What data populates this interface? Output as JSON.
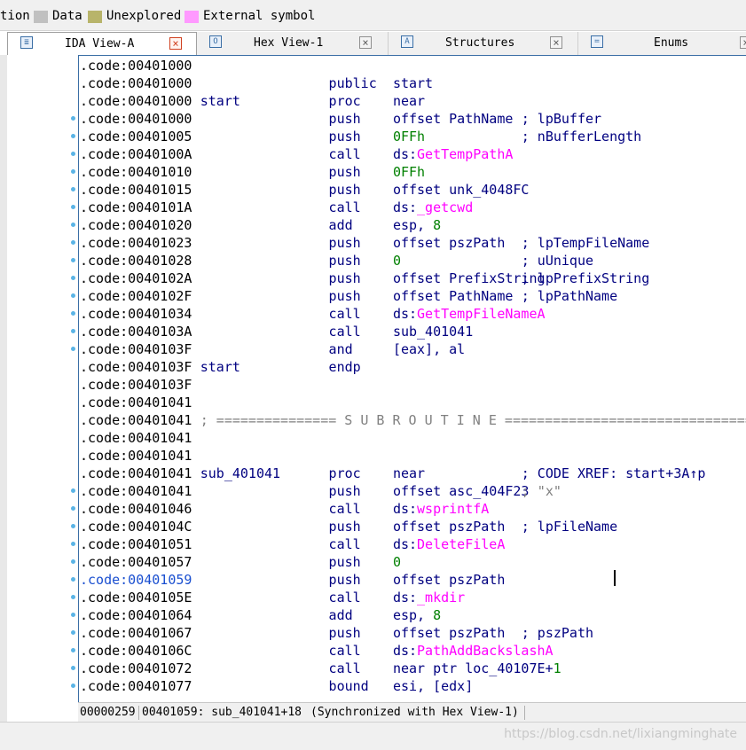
{
  "legend": [
    {
      "label": "tion",
      "color": ""
    },
    {
      "label": "Data",
      "color": "#c0c0c0"
    },
    {
      "label": "Unexplored",
      "color": "#b8b46a"
    },
    {
      "label": "External symbol",
      "color": "#ff99ff"
    }
  ],
  "tabs": [
    {
      "label": "IDA View-A",
      "icon": "ida-view-icon",
      "glyph": "≣"
    },
    {
      "label": "Hex View-1",
      "icon": "hex-view-icon",
      "glyph": "O"
    },
    {
      "label": "Structures",
      "icon": "structures-icon",
      "glyph": "A"
    },
    {
      "label": "Enums",
      "icon": "enums-icon",
      "glyph": "≔"
    }
  ],
  "listing": [
    {
      "addr": ".code:00401000",
      "label": "",
      "mnem": "",
      "ops": [],
      "comment": "",
      "bp": false
    },
    {
      "addr": ".code:00401000",
      "label": "",
      "mnem": "public",
      "ops": [
        {
          "t": "start",
          "c": "op"
        }
      ],
      "comment": "",
      "bp": false
    },
    {
      "addr": ".code:00401000",
      "label": "start",
      "mnem": "proc",
      "ops": [
        {
          "t": "near",
          "c": "op"
        }
      ],
      "comment": "",
      "bp": false
    },
    {
      "addr": ".code:00401000",
      "label": "",
      "mnem": "push",
      "ops": [
        {
          "t": "offset PathName",
          "c": "op"
        }
      ],
      "comment": "; lpBuffer",
      "bp": true
    },
    {
      "addr": ".code:00401005",
      "label": "",
      "mnem": "push",
      "ops": [
        {
          "t": "0FFh",
          "c": "num"
        }
      ],
      "comment": "; nBufferLength",
      "bp": true
    },
    {
      "addr": ".code:0040100A",
      "label": "",
      "mnem": "call",
      "ops": [
        {
          "t": "ds:",
          "c": "op"
        },
        {
          "t": "GetTempPathA",
          "c": "fn"
        }
      ],
      "comment": "",
      "bp": true
    },
    {
      "addr": ".code:00401010",
      "label": "",
      "mnem": "push",
      "ops": [
        {
          "t": "0FFh",
          "c": "num"
        }
      ],
      "comment": "",
      "bp": true
    },
    {
      "addr": ".code:00401015",
      "label": "",
      "mnem": "push",
      "ops": [
        {
          "t": "offset unk_4048FC",
          "c": "op"
        }
      ],
      "comment": "",
      "bp": true
    },
    {
      "addr": ".code:0040101A",
      "label": "",
      "mnem": "call",
      "ops": [
        {
          "t": "ds:",
          "c": "op"
        },
        {
          "t": "_getcwd",
          "c": "fn"
        }
      ],
      "comment": "",
      "bp": true
    },
    {
      "addr": ".code:00401020",
      "label": "",
      "mnem": "add",
      "ops": [
        {
          "t": "esp, ",
          "c": "op"
        },
        {
          "t": "8",
          "c": "num"
        }
      ],
      "comment": "",
      "bp": true
    },
    {
      "addr": ".code:00401023",
      "label": "",
      "mnem": "push",
      "ops": [
        {
          "t": "offset pszPath",
          "c": "op"
        }
      ],
      "comment": "; lpTempFileName",
      "bp": true
    },
    {
      "addr": ".code:00401028",
      "label": "",
      "mnem": "push",
      "ops": [
        {
          "t": "0",
          "c": "num"
        }
      ],
      "comment": "; uUnique",
      "bp": true
    },
    {
      "addr": ".code:0040102A",
      "label": "",
      "mnem": "push",
      "ops": [
        {
          "t": "offset PrefixString",
          "c": "op"
        }
      ],
      "comment": "; lpPrefixString",
      "bp": true
    },
    {
      "addr": ".code:0040102F",
      "label": "",
      "mnem": "push",
      "ops": [
        {
          "t": "offset PathName",
          "c": "op"
        }
      ],
      "comment": "; lpPathName",
      "bp": true
    },
    {
      "addr": ".code:00401034",
      "label": "",
      "mnem": "call",
      "ops": [
        {
          "t": "ds:",
          "c": "op"
        },
        {
          "t": "GetTempFileNameA",
          "c": "fn"
        }
      ],
      "comment": "",
      "bp": true
    },
    {
      "addr": ".code:0040103A",
      "label": "",
      "mnem": "call",
      "ops": [
        {
          "t": "sub_401041",
          "c": "op"
        }
      ],
      "comment": "",
      "bp": true
    },
    {
      "addr": ".code:0040103F",
      "label": "",
      "mnem": "and",
      "ops": [
        {
          "t": "[eax], al",
          "c": "op"
        }
      ],
      "comment": "",
      "bp": true
    },
    {
      "addr": ".code:0040103F",
      "label": "start",
      "mnem": "endp",
      "ops": [],
      "comment": "",
      "bp": false
    },
    {
      "addr": ".code:0040103F",
      "label": "",
      "mnem": "",
      "ops": [],
      "comment": "",
      "bp": false
    },
    {
      "addr": ".code:00401041",
      "label": "",
      "mnem": "",
      "ops": [],
      "comment": "",
      "bp": false
    },
    {
      "addr": ".code:00401041",
      "sep": "; =============== S U B R O U T I N E =======================================",
      "bp": false
    },
    {
      "addr": ".code:00401041",
      "label": "",
      "mnem": "",
      "ops": [],
      "comment": "",
      "bp": false
    },
    {
      "addr": ".code:00401041",
      "label": "",
      "mnem": "",
      "ops": [],
      "comment": "",
      "bp": false
    },
    {
      "addr": ".code:00401041",
      "label": "sub_401041",
      "mnem": "proc",
      "ops": [
        {
          "t": "near",
          "c": "op"
        }
      ],
      "comment": "; CODE XREF: start+3A↑p",
      "bp": false
    },
    {
      "addr": ".code:00401041",
      "label": "",
      "mnem": "push",
      "ops": [
        {
          "t": "offset asc_404F23",
          "c": "op"
        }
      ],
      "comment": "; \"x\"",
      "commentGray": true,
      "bp": true
    },
    {
      "addr": ".code:00401046",
      "label": "",
      "mnem": "call",
      "ops": [
        {
          "t": "ds:",
          "c": "op"
        },
        {
          "t": "wsprintfA",
          "c": "fn"
        }
      ],
      "comment": "",
      "bp": true
    },
    {
      "addr": ".code:0040104C",
      "label": "",
      "mnem": "push",
      "ops": [
        {
          "t": "offset pszPath",
          "c": "op"
        }
      ],
      "comment": "; lpFileName",
      "bp": true
    },
    {
      "addr": ".code:00401051",
      "label": "",
      "mnem": "call",
      "ops": [
        {
          "t": "ds:",
          "c": "op"
        },
        {
          "t": "DeleteFileA",
          "c": "fn"
        }
      ],
      "comment": "",
      "bp": true
    },
    {
      "addr": ".code:00401057",
      "label": "",
      "mnem": "push",
      "ops": [
        {
          "t": "0",
          "c": "num"
        }
      ],
      "comment": "",
      "bp": true
    },
    {
      "addr": ".code:00401059",
      "label": "",
      "mnem": "push",
      "ops": [
        {
          "t": "offset pszPath",
          "c": "op"
        }
      ],
      "comment": "",
      "bp": true,
      "current": true
    },
    {
      "addr": ".code:0040105E",
      "label": "",
      "mnem": "call",
      "ops": [
        {
          "t": "ds:",
          "c": "op"
        },
        {
          "t": "_mkdir",
          "c": "fn"
        }
      ],
      "comment": "",
      "bp": true
    },
    {
      "addr": ".code:00401064",
      "label": "",
      "mnem": "add",
      "ops": [
        {
          "t": "esp, ",
          "c": "op"
        },
        {
          "t": "8",
          "c": "num"
        }
      ],
      "comment": "",
      "bp": true
    },
    {
      "addr": ".code:00401067",
      "label": "",
      "mnem": "push",
      "ops": [
        {
          "t": "offset pszPath",
          "c": "op"
        }
      ],
      "comment": "; pszPath",
      "bp": true
    },
    {
      "addr": ".code:0040106C",
      "label": "",
      "mnem": "call",
      "ops": [
        {
          "t": "ds:",
          "c": "op"
        },
        {
          "t": "PathAddBackslashA",
          "c": "fn"
        }
      ],
      "comment": "",
      "bp": true
    },
    {
      "addr": ".code:00401072",
      "label": "",
      "mnem": "call",
      "ops": [
        {
          "t": "near ptr loc_40107E+",
          "c": "op"
        },
        {
          "t": "1",
          "c": "num"
        }
      ],
      "comment": "",
      "bp": true
    },
    {
      "addr": ".code:00401077",
      "label": "",
      "mnem": "bound",
      "ops": [
        {
          "t": "esi, [edx]",
          "c": "op"
        }
      ],
      "comment": "",
      "bp": true
    }
  ],
  "status": {
    "offset": "00000259",
    "location": "00401059: sub_401041+18",
    "sync": "(Synchronized with Hex View-1)"
  },
  "watermark": "https://blog.csdn.net/lixiangminghate"
}
